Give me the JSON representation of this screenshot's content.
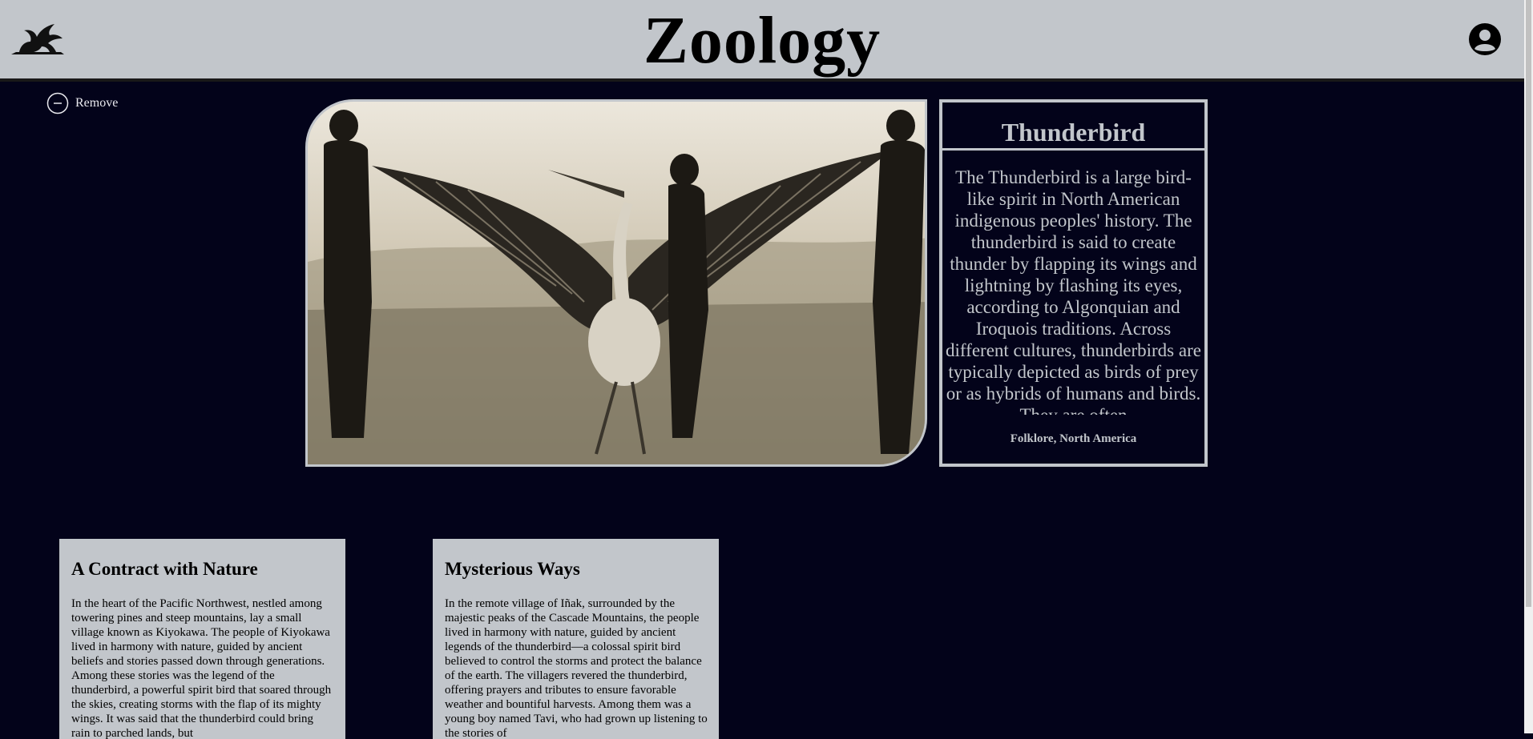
{
  "header": {
    "title": "Zoology",
    "logo_icon": "griffin-logo-icon",
    "account_icon": "user-account-icon"
  },
  "remove_button": {
    "label": "Remove",
    "icon": "minus-circle-icon"
  },
  "feature": {
    "image_alt": "Photograph of three men holding a large bird with outstretched wings",
    "card": {
      "title": "Thunderbird",
      "description": "The Thunderbird is a large bird-like spirit in North American indigenous peoples' history. The thunderbird is said to create thunder by flapping its wings and lightning by flashing its eyes, according to Algonquian and Iroquois traditions. Across different cultures, thunderbirds are typically depicted as birds of prey or as hybrids of humans and birds. They are often",
      "tag": "Folklore, North America"
    }
  },
  "stories": [
    {
      "title": "A Contract with Nature",
      "body": "In the heart of the Pacific Northwest, nestled among towering pines and steep mountains, lay a small village known as Kiyokawa. The people of Kiyokawa lived in harmony with nature, guided by ancient beliefs and stories passed down through generations. Among these stories was the legend of the thunderbird, a powerful spirit bird that soared through the skies, creating storms with the flap of its mighty wings. It was said that the thunderbird could bring rain to parched lands, but"
    },
    {
      "title": "Mysterious Ways",
      "body": "In the remote village of Iñak, surrounded by the majestic peaks of the Cascade Mountains, the people lived in harmony with nature, guided by ancient legends of the thunderbird—a colossal spirit bird believed to control the storms and protect the balance of the earth. The villagers revered the thunderbird, offering prayers and tributes to ensure favorable weather and bountiful harvests. Among them was a young boy named Tavi, who had grown up listening to the stories of"
    }
  ],
  "colors": {
    "background": "#03031a",
    "header_bg": "#c2c6cb",
    "card_border": "#c2c6cb"
  }
}
